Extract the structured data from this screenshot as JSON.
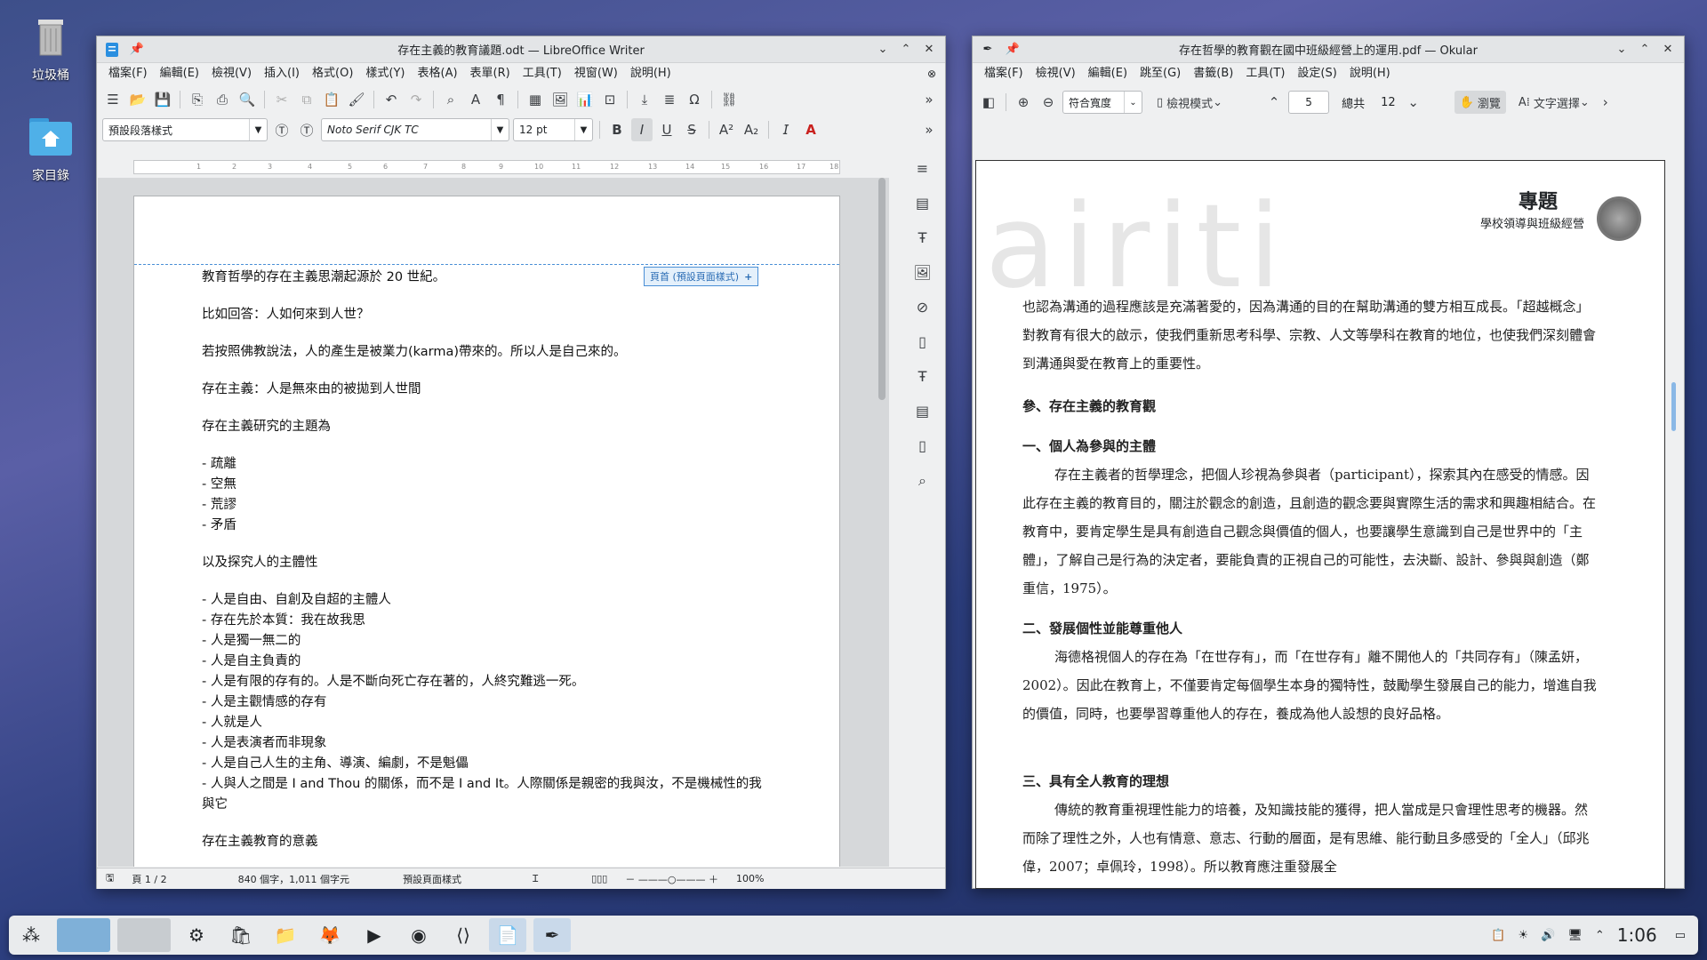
{
  "desktop": {
    "trash_label": "垃圾桶",
    "home_label": "家目錄"
  },
  "writer": {
    "title": "存在主義的教育議題.odt — LibreOffice Writer",
    "menu": [
      "檔案(F)",
      "編輯(E)",
      "檢視(V)",
      "插入(I)",
      "格式(O)",
      "樣式(Y)",
      "表格(A)",
      "表單(R)",
      "工具(T)",
      "視窗(W)",
      "說明(H)"
    ],
    "para_style": "預設段落樣式",
    "font_name": "Noto Serif CJK TC",
    "font_size": "12 pt",
    "header_tag": "頁首 (預設頁面樣式)",
    "lines": [
      "教育哲學的存在主義思潮起源於 20 世紀。",
      "比如回答：人如何來到人世？",
      "若按照佛教說法，人的產生是被業力(karma)帶來的。所以人是自己來的。",
      "存在主義：人是無來由的被拋到人世間",
      "存在主義研究的主題為"
    ],
    "list1": [
      "- 疏離",
      "- 空無",
      "- 荒謬",
      "- 矛盾"
    ],
    "line6": "以及探究人的主體性",
    "list2": [
      "- 人是自由、自創及自超的主體人",
      "- 存在先於本質：我在故我思",
      "- 人是獨一無二的",
      "- 人是自主負責的",
      "- 人是有限的存有的。人是不斷向死亡存在著的，人終究難逃一死。",
      "- 人是主觀情感的存有",
      "- 人就是人",
      "- 人是表演者而非現象",
      "- 人是自己人生的主角、導演、編劇，不是魁儡",
      "- 人與人之間是 I and Thou 的關係，而不是 I and It。人際關係是親密的我與汝，不是機械性的我與它"
    ],
    "line7": "存在主義教育的意義",
    "status": {
      "page": "頁 1 / 2",
      "words": "840 個字，1,011 個字元",
      "style": "預設頁面樣式",
      "zoom": "100%"
    }
  },
  "okular": {
    "title": "存在哲學的教育觀在國中班級經營上的運用.pdf — Okular",
    "menu": [
      "檔案(F)",
      "檢視(V)",
      "編輯(E)",
      "跳至(G)",
      "書籤(B)",
      "工具(T)",
      "設定(S)",
      "說明(H)"
    ],
    "zoom": "符合寬度",
    "view_mode": "檢視模式",
    "page_num": "5",
    "total_label": "總共",
    "total": "12",
    "browse": "瀏覽",
    "select": "文字選擇",
    "header_title": "專題",
    "header_sub": "學校領導與班級經營",
    "watermark": "airiti",
    "p0": "也認為溝通的過程應該是充滿著愛的，因為溝通的目的在幫助溝通的雙方相互成長。「超越概念」對教育有很大的啟示，使我們重新思考科學、宗教、人文等學科在教育的地位，也使我們深刻體會到溝通與愛在教育上的重要性。",
    "h3": "參、存在主義的教育觀",
    "h4a": "一、個人為參與的主體",
    "p1": "存在主義者的哲學理念，把個人珍視為參與者（participant），探索其內在感受的情感。因此存在主義的教育目的，關注於觀念的創造，且創造的觀念要與實際生活的需求和興趣相結合。在教育中，要肯定學生是具有創造自己觀念與價值的個人，也要讓學生意識到自己是世界中的「主體」，了解自己是行為的決定者，要能負責的正視自己的可能性，去決斷、設計、參與與創造（鄭重信，1975）。",
    "h4b": "二、發展個性並能尊重他人",
    "p2": "海德格視個人的存在為「在世存有」，而「在世存有」離不開他人的「共同存有」（陳孟妍，2002）。因此在教育上，不僅要肯定每個學生本身的獨特性，鼓勵學生發展自己的能力，增進自我的價值，同時，也要學習尊重他人的存在，養成為他人設想的良好品格。",
    "h4c": "三、具有全人教育的理想",
    "p3": "傳統的教育重視理性能力的培養，及知識技能的獲得，把人當成是只會理性思考的機器。然而除了理性之外，人也有情意、意志、行動的層面，是有思維、能行動且多感受的「全人」（邱兆偉，2007；卓佩玲，1998）。所以教育應注重發展全"
  },
  "taskbar": {
    "clock": "1:06"
  }
}
